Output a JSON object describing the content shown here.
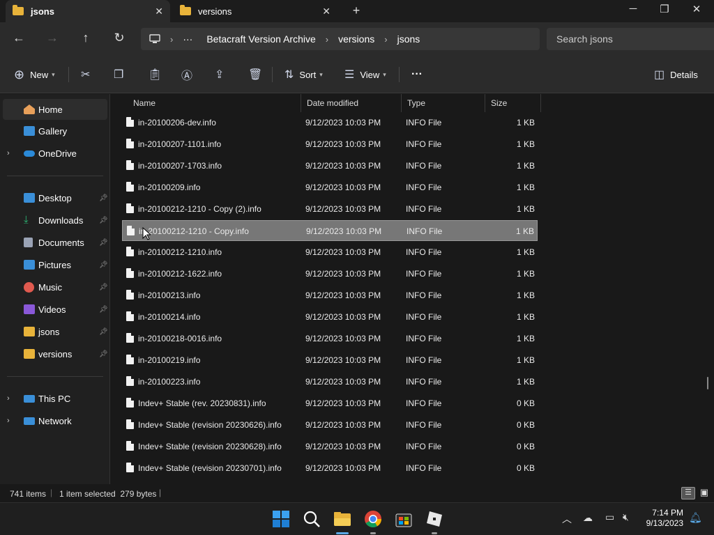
{
  "tabs": [
    {
      "label": "jsons",
      "active": true
    },
    {
      "label": "versions",
      "active": false
    }
  ],
  "window_controls": {
    "minimize": "─",
    "maximize": "❐",
    "close": "✕",
    "new_tab": "+"
  },
  "breadcrumb": [
    "Betacraft Version Archive",
    "versions",
    "jsons"
  ],
  "breadcrumb_more": "···",
  "search": {
    "placeholder": "Search jsons"
  },
  "toolbar": {
    "new_label": "New",
    "sort_label": "Sort",
    "view_label": "View",
    "more": "···",
    "details_label": "Details"
  },
  "sidebar": {
    "top": [
      {
        "label": "Home",
        "icon": "home-icon",
        "selected": true
      },
      {
        "label": "Gallery",
        "icon": "gallery-icon"
      },
      {
        "label": "OneDrive",
        "icon": "onedrive-icon",
        "expandable": true
      }
    ],
    "pinned": [
      {
        "label": "Desktop",
        "icon": "desktop-icon",
        "color": "#3a8fd8"
      },
      {
        "label": "Downloads",
        "icon": "downloads-icon",
        "color": "#2bb673"
      },
      {
        "label": "Documents",
        "icon": "documents-icon",
        "color": "#9aa3b5"
      },
      {
        "label": "Pictures",
        "icon": "pictures-icon",
        "color": "#3a8fd8"
      },
      {
        "label": "Music",
        "icon": "music-icon",
        "color": "#e05a4f"
      },
      {
        "label": "Videos",
        "icon": "videos-icon",
        "color": "#8a58d8"
      },
      {
        "label": "jsons",
        "icon": "folder-icon",
        "color": "#e8b33a"
      },
      {
        "label": "versions",
        "icon": "folder-icon",
        "color": "#e8b33a"
      }
    ],
    "bottom": [
      {
        "label": "This PC",
        "icon": "pc-icon"
      },
      {
        "label": "Network",
        "icon": "network-icon"
      }
    ]
  },
  "columns": {
    "name": "Name",
    "date": "Date modified",
    "type": "Type",
    "size": "Size"
  },
  "files": [
    {
      "name": "in-20100206-dev.info",
      "date": "9/12/2023 10:03 PM",
      "type": "INFO File",
      "size": "1 KB"
    },
    {
      "name": "in-20100207-1101.info",
      "date": "9/12/2023 10:03 PM",
      "type": "INFO File",
      "size": "1 KB"
    },
    {
      "name": "in-20100207-1703.info",
      "date": "9/12/2023 10:03 PM",
      "type": "INFO File",
      "size": "1 KB"
    },
    {
      "name": "in-20100209.info",
      "date": "9/12/2023 10:03 PM",
      "type": "INFO File",
      "size": "1 KB"
    },
    {
      "name": "in-20100212-1210 - Copy (2).info",
      "date": "9/12/2023 10:03 PM",
      "type": "INFO File",
      "size": "1 KB"
    },
    {
      "name": "in-20100212-1210 - Copy.info",
      "date": "9/12/2023 10:03 PM",
      "type": "INFO File",
      "size": "1 KB",
      "selected": true
    },
    {
      "name": "in-20100212-1210.info",
      "date": "9/12/2023 10:03 PM",
      "type": "INFO File",
      "size": "1 KB"
    },
    {
      "name": "in-20100212-1622.info",
      "date": "9/12/2023 10:03 PM",
      "type": "INFO File",
      "size": "1 KB"
    },
    {
      "name": "in-20100213.info",
      "date": "9/12/2023 10:03 PM",
      "type": "INFO File",
      "size": "1 KB"
    },
    {
      "name": "in-20100214.info",
      "date": "9/12/2023 10:03 PM",
      "type": "INFO File",
      "size": "1 KB"
    },
    {
      "name": "in-20100218-0016.info",
      "date": "9/12/2023 10:03 PM",
      "type": "INFO File",
      "size": "1 KB"
    },
    {
      "name": "in-20100219.info",
      "date": "9/12/2023 10:03 PM",
      "type": "INFO File",
      "size": "1 KB"
    },
    {
      "name": "in-20100223.info",
      "date": "9/12/2023 10:03 PM",
      "type": "INFO File",
      "size": "1 KB"
    },
    {
      "name": "Indev+ Stable (rev. 20230831).info",
      "date": "9/12/2023 10:03 PM",
      "type": "INFO File",
      "size": "0 KB"
    },
    {
      "name": "Indev+ Stable (revision 20230626).info",
      "date": "9/12/2023 10:03 PM",
      "type": "INFO File",
      "size": "0 KB"
    },
    {
      "name": "Indev+ Stable (revision 20230628).info",
      "date": "9/12/2023 10:03 PM",
      "type": "INFO File",
      "size": "0 KB"
    },
    {
      "name": "Indev+ Stable (revision 20230701).info",
      "date": "9/12/2023 10:03 PM",
      "type": "INFO File",
      "size": "0 KB"
    }
  ],
  "status": {
    "items": "741 items",
    "selection": "1 item selected  279 bytes"
  },
  "clock": {
    "time": "7:14 PM",
    "date": "9/13/2023"
  },
  "colors": {
    "accent": "#0078d4",
    "folder": "#e8b33a",
    "selection": "#777777"
  }
}
